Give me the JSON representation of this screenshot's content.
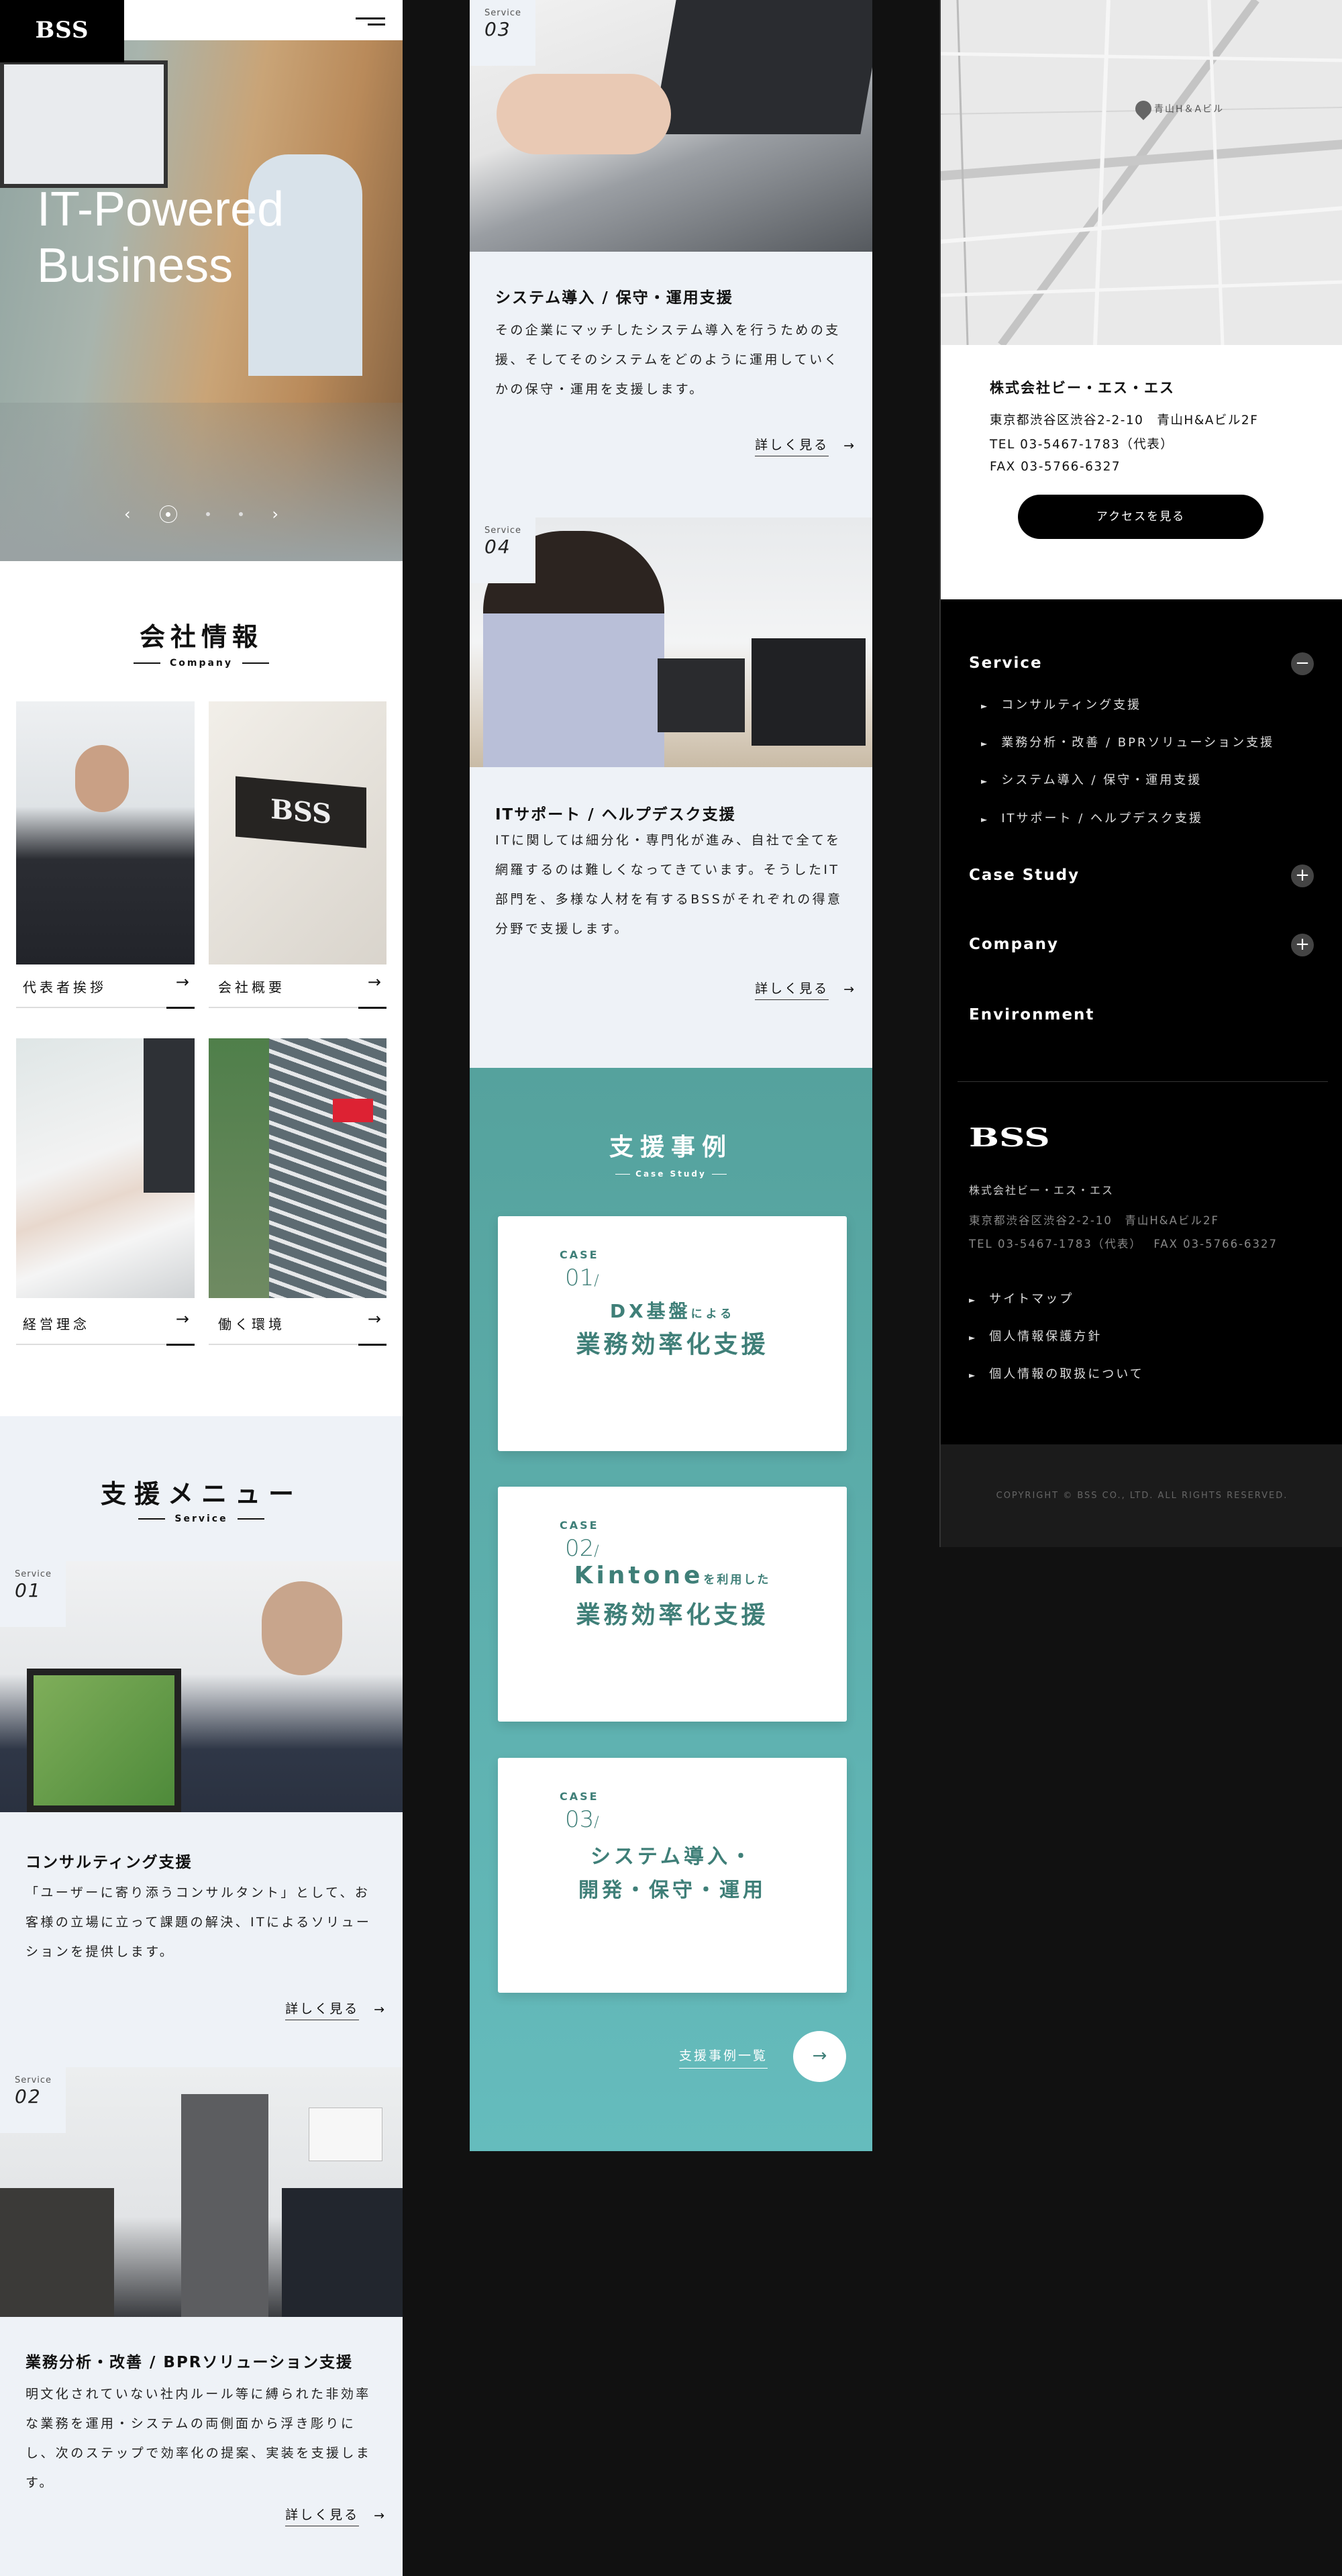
{
  "header": {
    "logo": "BSS",
    "menu_icon": "hamburger-icon"
  },
  "hero": {
    "title_line1": "IT-Powered",
    "title_line2": "Business",
    "slides": 3,
    "active_slide": 1
  },
  "company": {
    "title": "会社情報",
    "subtitle": "Company",
    "cards": [
      {
        "label": "代表者挨拶"
      },
      {
        "label": "会社概要"
      },
      {
        "label": "経営理念"
      },
      {
        "label": "働く環境"
      }
    ]
  },
  "service": {
    "title": "支援メニュー",
    "subtitle": "Service",
    "more_label": "詳しく見る",
    "items": [
      {
        "tag": "Service",
        "num": "01",
        "title": "コンサルティング支援",
        "desc": "「ユーザーに寄り添うコンサルタント」として、お客様の立場に立って課題の解決、ITによるソリューションを提供します。"
      },
      {
        "tag": "Service",
        "num": "02",
        "title": "業務分析・改善 / BPRソリューション支援",
        "desc": "明文化されていない社内ルール等に縛られた非効率な業務を運用・システムの両側面から浮き彫りにし、次のステップで効率化の提案、実装を支援します。"
      },
      {
        "tag": "Service",
        "num": "03",
        "title": "システム導入 / 保守・運用支援",
        "desc": "その企業にマッチしたシステム導入を行うための支援、そしてそのシステムをどのように運用していくかの保守・運用を支援します。"
      },
      {
        "tag": "Service",
        "num": "04",
        "title": "ITサポート / ヘルプデスク支援",
        "desc": "ITに関しては細分化・専門化が進み、自社で全てを網羅するのは難しくなってきています。そうしたIT部門を、多様な人材を有するBSSがそれぞれの得意分野で支援します。"
      }
    ]
  },
  "case_study": {
    "title": "支援事例",
    "subtitle": "Case Study",
    "list_label": "支援事例一覧",
    "bg_color": "#5aa8a4",
    "accent": "#3f7f78",
    "cases": [
      {
        "label": "CASE",
        "num": "01",
        "line1_main": "DX基盤",
        "line1_small": "による",
        "line2": "業務効率化支援"
      },
      {
        "label": "CASE",
        "num": "02",
        "line1_main": "Kintone",
        "line1_small": "を利用した",
        "line2": "業務効率化支援"
      },
      {
        "label": "CASE",
        "num": "03",
        "line1_main": "システム導入・",
        "line1_small": "",
        "line2": "開発・保守・運用"
      }
    ]
  },
  "access": {
    "map_marker_label": "青山H＆Aビル",
    "company_name": "株式会社ビー・エス・エス",
    "address": "東京都渋谷区渋谷2-2-10　青山H&Aビル2F",
    "tel": "TEL 03-5467-1783（代表）",
    "fax": "FAX 03-5766-6327",
    "button": "アクセスを見る"
  },
  "footer": {
    "nav": [
      {
        "label": "Service",
        "toggle": "−",
        "expanded": true,
        "children": [
          "コンサルティング支援",
          "業務分析・改善 / BPRソリューション支援",
          "システム導入 / 保守・運用支援",
          "ITサポート / ヘルプデスク支援"
        ]
      },
      {
        "label": "Case Study",
        "toggle": "+"
      },
      {
        "label": "Company",
        "toggle": "+"
      },
      {
        "label": "Environment"
      }
    ],
    "logo": "BSS",
    "company_name": "株式会社ビー・エス・エス",
    "address": "東京都渋谷区渋谷2-2-10　青山H&Aビル2F",
    "tel_fax": "TEL 03-5467-1783（代表）　 FAX 03-5766-6327",
    "links": [
      "サイトマップ",
      "個人情報保護方針",
      "個人情報の取扱について"
    ],
    "copyright": "COPYRIGHT © BSS CO., LTD. ALL RIGHTS RESERVED."
  }
}
